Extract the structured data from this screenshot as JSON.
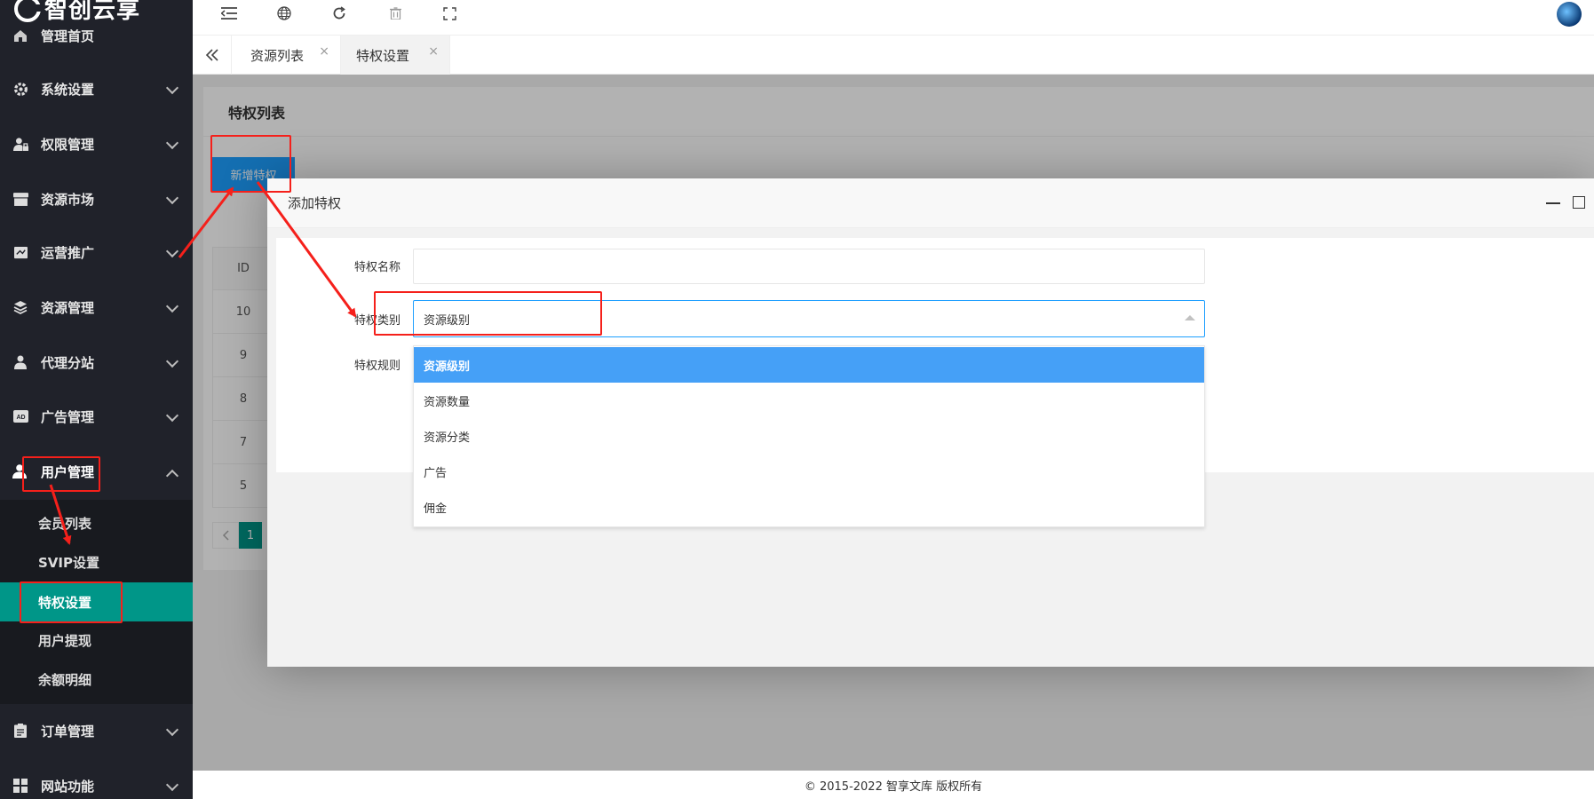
{
  "app": {
    "logo_text": "智创云享"
  },
  "sidebar": {
    "items": [
      {
        "label": "管理首页",
        "icon": "home-icon"
      },
      {
        "label": "系统设置",
        "icon": "gear-icon"
      },
      {
        "label": "权限管理",
        "icon": "user-lock-icon"
      },
      {
        "label": "资源市场",
        "icon": "store-icon"
      },
      {
        "label": "运营推广",
        "icon": "flag-icon"
      },
      {
        "label": "资源管理",
        "icon": "layers-icon"
      },
      {
        "label": "代理分站",
        "icon": "agent-icon"
      },
      {
        "label": "广告管理",
        "icon": "ad-icon"
      },
      {
        "label": "用户管理",
        "icon": "user-icon"
      },
      {
        "label": "订单管理",
        "icon": "clipboard-icon"
      },
      {
        "label": "网站功能",
        "icon": "grid-icon"
      }
    ],
    "submenu": [
      {
        "label": "会员列表"
      },
      {
        "label": "SVIP设置"
      },
      {
        "label": "特权设置"
      },
      {
        "label": "用户提现"
      },
      {
        "label": "余额明细"
      }
    ]
  },
  "tabs": [
    {
      "label": "资源列表",
      "close": "×"
    },
    {
      "label": "特权设置",
      "close": "×"
    }
  ],
  "page": {
    "title": "特权列表",
    "add_button": "新增特权",
    "table": {
      "header": "ID",
      "rows": [
        "10",
        "9",
        "8",
        "7",
        "5"
      ]
    },
    "pager": {
      "current": "1"
    }
  },
  "modal": {
    "title": "添加特权",
    "fields": {
      "name_label": "特权名称",
      "name_value": "",
      "type_label": "特权类别",
      "type_value": "资源级别",
      "rule_label": "特权规则"
    },
    "options": [
      "资源级别",
      "资源数量",
      "资源分类",
      "广告",
      "佣金"
    ]
  },
  "footer": {
    "text": "© 2015-2022 智享文库 版权所有"
  },
  "colors": {
    "sidebar": "#20222a",
    "active": "#009688",
    "primary": "#1e9fff",
    "annotation": "#f5201b"
  }
}
